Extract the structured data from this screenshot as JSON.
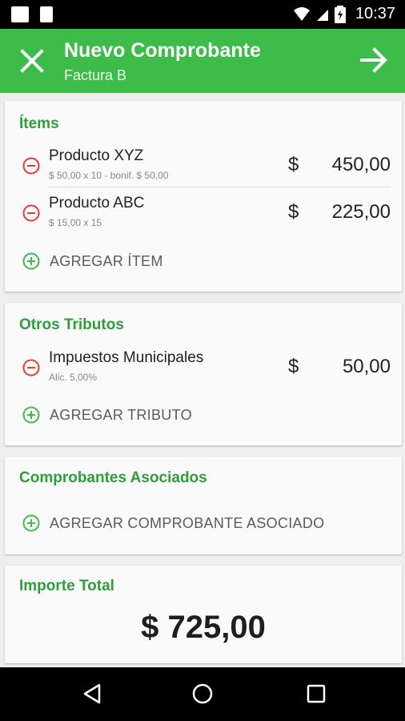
{
  "status_bar": {
    "time": "10:37"
  },
  "app_bar": {
    "title": "Nuevo Comprobante",
    "subtitle": "Factura B"
  },
  "items_section": {
    "title": "Ítems",
    "items": [
      {
        "name": "Producto XYZ",
        "detail": "$ 50,00 x 10 - bonif. $ 50,00",
        "currency": "$",
        "amount": "450,00"
      },
      {
        "name": "Producto ABC",
        "detail": "$ 15,00 x 15",
        "currency": "$",
        "amount": "225,00"
      }
    ],
    "add_label": "AGREGAR ÍTEM"
  },
  "tributos_section": {
    "title": "Otros Tributos",
    "items": [
      {
        "name": "Impuestos Municipales",
        "detail": "Alic. 5,00%",
        "currency": "$",
        "amount": "50,00"
      }
    ],
    "add_label": "AGREGAR TRIBUTO"
  },
  "asociados_section": {
    "title": "Comprobantes Asociados",
    "add_label": "AGREGAR COMPROBANTE ASOCIADO"
  },
  "total_section": {
    "title": "Importe Total",
    "value": "$ 725,00"
  },
  "colors": {
    "primary": "#3dbc4a",
    "section_title": "#2e9e3b",
    "remove": "#e53935",
    "add": "#3dbc4a"
  },
  "icons": [
    "close-icon",
    "arrow-forward-icon",
    "remove-circle-icon",
    "add-circle-icon",
    "nav-back-icon",
    "nav-home-icon",
    "nav-recents-icon"
  ]
}
